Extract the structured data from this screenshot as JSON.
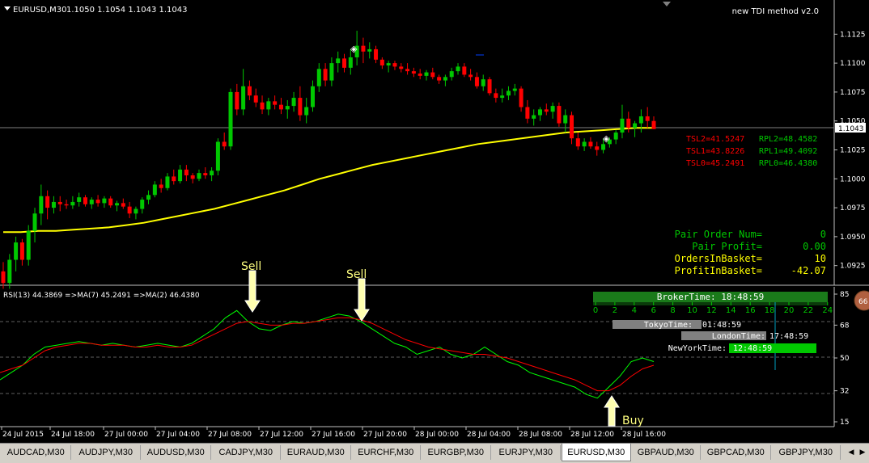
{
  "main_chart": {
    "header_symbol": "EURUSD,M30",
    "header_ohlc": "1.1050 1.1054 1.1043 1.1043",
    "indicator_name": "new TDI method v2.0",
    "current_price": "1.1043",
    "price_axis": [
      "1.1125",
      "1.1100",
      "1.1075",
      "1.1050",
      "1.1025",
      "1.1000",
      "1.0975",
      "1.0950",
      "1.0925"
    ],
    "tsl_lines": [
      {
        "tsl": "TSL2=41.5247",
        "rpl": "RPL2=48.4582"
      },
      {
        "tsl": "TSL1=43.8226",
        "rpl": "RPL1=49.4092"
      },
      {
        "tsl": "TSL0=45.2491",
        "rpl": "RPL0=46.4380"
      }
    ],
    "stats": [
      {
        "label": "Pair Order Num=",
        "value": "0",
        "color": "#00c800"
      },
      {
        "label": "Pair Profit=",
        "value": "0.00",
        "color": "#00c800"
      },
      {
        "label": "OrdersInBasket=",
        "value": "10",
        "color": "#ffff00"
      },
      {
        "label": "ProfitInBasket=",
        "value": "-42.07",
        "color": "#ffff00"
      }
    ]
  },
  "rsi_panel": {
    "header": "RSI(13) 44.3869 =>MA(7) 45.2491 =>MA(2) 46.4380",
    "axis": [
      "85",
      "68",
      "50",
      "32",
      "15"
    ],
    "annotations": {
      "sell1": "Sell",
      "sell2": "Sell",
      "buy": "Buy"
    }
  },
  "time_panel": {
    "broker_time": "BrokerTime: 18:48:59",
    "hours": [
      "0",
      "2",
      "4",
      "6",
      "8",
      "10",
      "12",
      "14",
      "16",
      "18",
      "20",
      "22",
      "24"
    ],
    "tokyo_label": "TokyoTime:",
    "tokyo_value": "01:48:59",
    "london_label": "LondonTime:",
    "london_value": "17:48:59",
    "newyork_label": "NewYorkTime:",
    "newyork_value": "12:48:59"
  },
  "time_axis": [
    "24 Jul 2015",
    "24 Jul 18:00",
    "27 Jul 00:00",
    "27 Jul 04:00",
    "27 Jul 08:00",
    "27 Jul 12:00",
    "27 Jul 16:00",
    "27 Jul 20:00",
    "28 Jul 00:00",
    "28 Jul 04:00",
    "28 Jul 08:00",
    "28 Jul 12:00",
    "28 Jul 16:00"
  ],
  "tabs": [
    "AUDCAD,M30",
    "AUDJPY,M30",
    "AUDUSD,M30",
    "CADJPY,M30",
    "EURAUD,M30",
    "EURCHF,M30",
    "EURGBP,M30",
    "EURJPY,M30",
    "EURUSD,M30",
    "GBPAUD,M30",
    "GBPCAD,M30",
    "GBPJPY,M30"
  ],
  "active_tab": "EURUSD,M30",
  "colors": {
    "bull": "#00c800",
    "bear": "#ff0000",
    "ma": "#ffff00",
    "rsi": "#00ff00",
    "signal": "#ff0000"
  },
  "chart_data": {
    "type": "candlestick",
    "price_range": [
      1.0915,
      1.1135
    ],
    "candles": [
      [
        1.092,
        1.0928,
        1.0905,
        1.091
      ],
      [
        1.091,
        1.0935,
        1.0905,
        1.093
      ],
      [
        1.093,
        1.095,
        1.092,
        1.0945
      ],
      [
        1.0945,
        1.0948,
        1.0925,
        1.093
      ],
      [
        1.093,
        1.096,
        1.0925,
        1.0955
      ],
      [
        1.0955,
        1.0975,
        1.0945,
        1.097
      ],
      [
        1.097,
        1.0995,
        1.096,
        1.0985
      ],
      [
        1.0985,
        1.099,
        1.0965,
        1.0975
      ],
      [
        1.0975,
        1.0985,
        1.097,
        1.098
      ],
      [
        1.098,
        1.0985,
        1.0972,
        1.0978
      ],
      [
        1.0978,
        1.0982,
        1.0974,
        1.0977
      ],
      [
        1.0977,
        1.0985,
        1.0974,
        1.098
      ],
      [
        1.098,
        1.0988,
        1.0976,
        1.0984
      ],
      [
        1.0984,
        1.0986,
        1.0976,
        1.0978
      ],
      [
        1.0978,
        1.0984,
        1.0974,
        1.0982
      ],
      [
        1.0982,
        1.0986,
        1.0976,
        1.0979
      ],
      [
        1.0979,
        1.0985,
        1.0975,
        1.0983
      ],
      [
        1.0983,
        1.0985,
        1.0975,
        1.0977
      ],
      [
        1.0977,
        1.0981,
        1.0972,
        1.0979
      ],
      [
        1.0979,
        1.0983,
        1.0974,
        1.0976
      ],
      [
        1.0976,
        1.098,
        1.0966,
        1.097
      ],
      [
        1.097,
        1.0976,
        1.0965,
        1.0974
      ],
      [
        1.0974,
        1.0984,
        1.097,
        1.0982
      ],
      [
        1.0982,
        1.099,
        1.0978,
        1.0986
      ],
      [
        1.0986,
        1.0998,
        1.0984,
        1.0995
      ],
      [
        1.0995,
        1.1,
        1.0988,
        1.0992
      ],
      [
        1.0992,
        1.1005,
        1.099,
        1.1002
      ],
      [
        1.1002,
        1.1008,
        1.0995,
        1.0998
      ],
      [
        1.0998,
        1.1012,
        1.0996,
        1.1008
      ],
      [
        1.1008,
        1.1012,
        1.0998,
        1.1003
      ],
      [
        1.1003,
        1.1005,
        1.0996,
        1.1
      ],
      [
        1.1,
        1.1008,
        1.0998,
        1.1005
      ],
      [
        1.1005,
        1.101,
        1.1,
        1.1003
      ],
      [
        1.1003,
        1.101,
        1.0998,
        1.1007
      ],
      [
        1.1007,
        1.1035,
        1.1003,
        1.1032
      ],
      [
        1.1032,
        1.104,
        1.1025,
        1.1028
      ],
      [
        1.1028,
        1.1078,
        1.1025,
        1.1075
      ],
      [
        1.1075,
        1.1082,
        1.1055,
        1.106
      ],
      [
        1.106,
        1.1095,
        1.1055,
        1.108
      ],
      [
        1.108,
        1.1085,
        1.1068,
        1.1072
      ],
      [
        1.1072,
        1.1078,
        1.1062,
        1.1066
      ],
      [
        1.1066,
        1.1072,
        1.1056,
        1.106
      ],
      [
        1.106,
        1.107,
        1.1055,
        1.1067
      ],
      [
        1.1067,
        1.1072,
        1.106,
        1.1064
      ],
      [
        1.1064,
        1.107,
        1.1056,
        1.106
      ],
      [
        1.106,
        1.1068,
        1.1052,
        1.1063
      ],
      [
        1.1063,
        1.1075,
        1.1058,
        1.107
      ],
      [
        1.107,
        1.108,
        1.105,
        1.1055
      ],
      [
        1.1055,
        1.107,
        1.1048,
        1.1062
      ],
      [
        1.1062,
        1.1085,
        1.1058,
        1.108
      ],
      [
        1.108,
        1.11,
        1.1075,
        1.1095
      ],
      [
        1.1095,
        1.11,
        1.108,
        1.1085
      ],
      [
        1.1085,
        1.1105,
        1.108,
        1.11
      ],
      [
        1.11,
        1.111,
        1.1092,
        1.1104
      ],
      [
        1.1104,
        1.1108,
        1.1092,
        1.1096
      ],
      [
        1.1096,
        1.1112,
        1.109,
        1.1105
      ],
      [
        1.1105,
        1.1128,
        1.1098,
        1.1115
      ],
      [
        1.1115,
        1.1122,
        1.11,
        1.111
      ],
      [
        1.111,
        1.1118,
        1.1104,
        1.1112
      ],
      [
        1.1112,
        1.1115,
        1.11,
        1.1103
      ],
      [
        1.1103,
        1.1105,
        1.1095,
        1.1098
      ],
      [
        1.1098,
        1.1102,
        1.1092,
        1.11
      ],
      [
        1.11,
        1.1102,
        1.1094,
        1.1097
      ],
      [
        1.1097,
        1.11,
        1.1092,
        1.1095
      ],
      [
        1.1095,
        1.11,
        1.109,
        1.1093
      ],
      [
        1.1093,
        1.1096,
        1.1088,
        1.1091
      ],
      [
        1.1091,
        1.1095,
        1.1086,
        1.1089
      ],
      [
        1.1089,
        1.1094,
        1.1085,
        1.1092
      ],
      [
        1.1092,
        1.1096,
        1.1086,
        1.1088
      ],
      [
        1.1088,
        1.109,
        1.1082,
        1.1085
      ],
      [
        1.1085,
        1.109,
        1.108,
        1.1088
      ],
      [
        1.1088,
        1.1096,
        1.1085,
        1.1093
      ],
      [
        1.1093,
        1.11,
        1.109,
        1.1097
      ],
      [
        1.1097,
        1.11,
        1.1088,
        1.109
      ],
      [
        1.109,
        1.1095,
        1.1085,
        1.1088
      ],
      [
        1.1088,
        1.1092,
        1.1078,
        1.108
      ],
      [
        1.108,
        1.109,
        1.1076,
        1.1086
      ],
      [
        1.1086,
        1.1088,
        1.1072,
        1.1074
      ],
      [
        1.1074,
        1.1078,
        1.1066,
        1.107
      ],
      [
        1.107,
        1.1078,
        1.1066,
        1.1072
      ],
      [
        1.1072,
        1.108,
        1.1068,
        1.1076
      ],
      [
        1.1076,
        1.1082,
        1.1072,
        1.1078
      ],
      [
        1.1078,
        1.108,
        1.1058,
        1.1062
      ],
      [
        1.1062,
        1.1068,
        1.1048,
        1.1052
      ],
      [
        1.1052,
        1.106,
        1.1046,
        1.1055
      ],
      [
        1.1055,
        1.1062,
        1.105,
        1.106
      ],
      [
        1.106,
        1.1065,
        1.1055,
        1.1058
      ],
      [
        1.1058,
        1.1066,
        1.1052,
        1.1063
      ],
      [
        1.1063,
        1.1066,
        1.1045,
        1.1048
      ],
      [
        1.1048,
        1.106,
        1.104,
        1.1055
      ],
      [
        1.1055,
        1.1058,
        1.103,
        1.1035
      ],
      [
        1.1035,
        1.104,
        1.1025,
        1.1028
      ],
      [
        1.1028,
        1.1035,
        1.1024,
        1.1032
      ],
      [
        1.1032,
        1.1036,
        1.1026,
        1.1028
      ],
      [
        1.1028,
        1.1032,
        1.102,
        1.1025
      ],
      [
        1.1025,
        1.1035,
        1.1022,
        1.103
      ],
      [
        1.103,
        1.1036,
        1.1027,
        1.1034
      ],
      [
        1.1034,
        1.1042,
        1.103,
        1.104
      ],
      [
        1.104,
        1.1064,
        1.1035,
        1.1052
      ],
      [
        1.1052,
        1.1058,
        1.104,
        1.1044
      ],
      [
        1.1044,
        1.105,
        1.1036,
        1.1048
      ],
      [
        1.1048,
        1.106,
        1.104,
        1.1054
      ],
      [
        1.1054,
        1.1062,
        1.1044,
        1.105
      ],
      [
        1.105,
        1.1054,
        1.1043,
        1.1043
      ]
    ],
    "moving_average": [
      1.0954,
      1.0954,
      1.0955,
      1.0955,
      1.0956,
      1.0957,
      1.0958,
      1.096,
      1.0962,
      1.0965,
      1.0968,
      1.0971,
      1.0974,
      1.0978,
      1.0982,
      1.0986,
      1.099,
      1.0995,
      1.1,
      1.1004,
      1.1008,
      1.1012,
      1.1015,
      1.1018,
      1.1021,
      1.1024,
      1.1027,
      1.103,
      1.1032,
      1.1034,
      1.1036,
      1.1038,
      1.104,
      1.1041,
      1.1042,
      1.1043,
      1.1044,
      1.1044
    ],
    "rsi_range": [
      15,
      85
    ],
    "rsi": [
      38,
      42,
      46,
      52,
      56,
      57,
      58,
      59,
      58,
      57,
      58,
      57,
      56,
      57,
      58,
      57,
      56,
      58,
      62,
      66,
      72,
      76,
      70,
      66,
      65,
      68,
      70,
      69,
      70,
      72,
      74,
      73,
      70,
      66,
      62,
      58,
      56,
      52,
      54,
      56,
      52,
      50,
      52,
      56,
      52,
      48,
      46,
      42,
      40,
      38,
      36,
      34,
      30,
      28,
      34,
      40,
      48,
      50,
      48
    ],
    "rsi_signal": [
      42,
      44,
      46,
      50,
      54,
      56,
      57,
      58,
      58,
      57,
      57,
      57,
      56,
      56,
      57,
      56,
      56,
      57,
      60,
      63,
      66,
      69,
      70,
      69,
      68,
      68,
      69,
      69,
      70,
      71,
      72,
      72,
      71,
      69,
      66,
      63,
      60,
      58,
      56,
      55,
      54,
      53,
      52,
      52,
      51,
      50,
      48,
      46,
      44,
      42,
      40,
      38,
      35,
      32,
      32,
      35,
      40,
      44,
      46
    ]
  }
}
